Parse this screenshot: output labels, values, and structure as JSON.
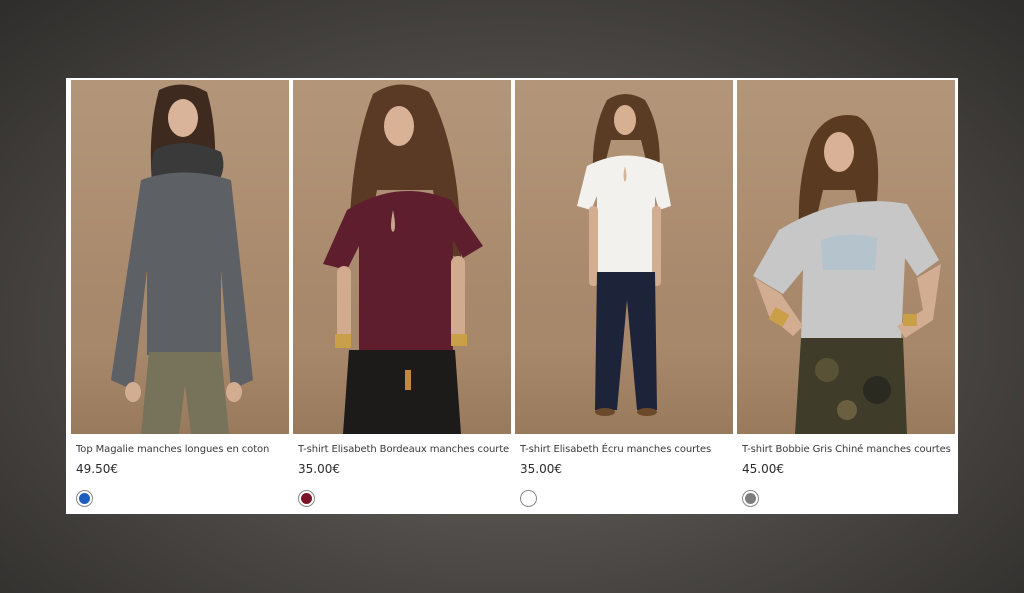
{
  "products": [
    {
      "title": "Top Magalie manches longues en coton",
      "price": "49.50€",
      "swatch_color": "#1c5fbf",
      "image": "model-grey-long-sleeve-top-khaki-pants"
    },
    {
      "title": "T-shirt Elisabeth Bordeaux manches courte",
      "price": "35.00€",
      "swatch_color": "#7a1426",
      "image": "model-burgundy-tshirt-black-leather-pants"
    },
    {
      "title": "T-shirt Elisabeth Écru manches courtes",
      "price": "35.00€",
      "swatch_color": "#ffffff",
      "image": "model-ecru-tshirt-dark-jeans"
    },
    {
      "title": "T-shirt Bobbie Gris Chiné manches courtes",
      "price": "45.00€",
      "swatch_color": "#7d7d7d",
      "image": "model-grey-tshirt-camo-pants"
    }
  ]
}
